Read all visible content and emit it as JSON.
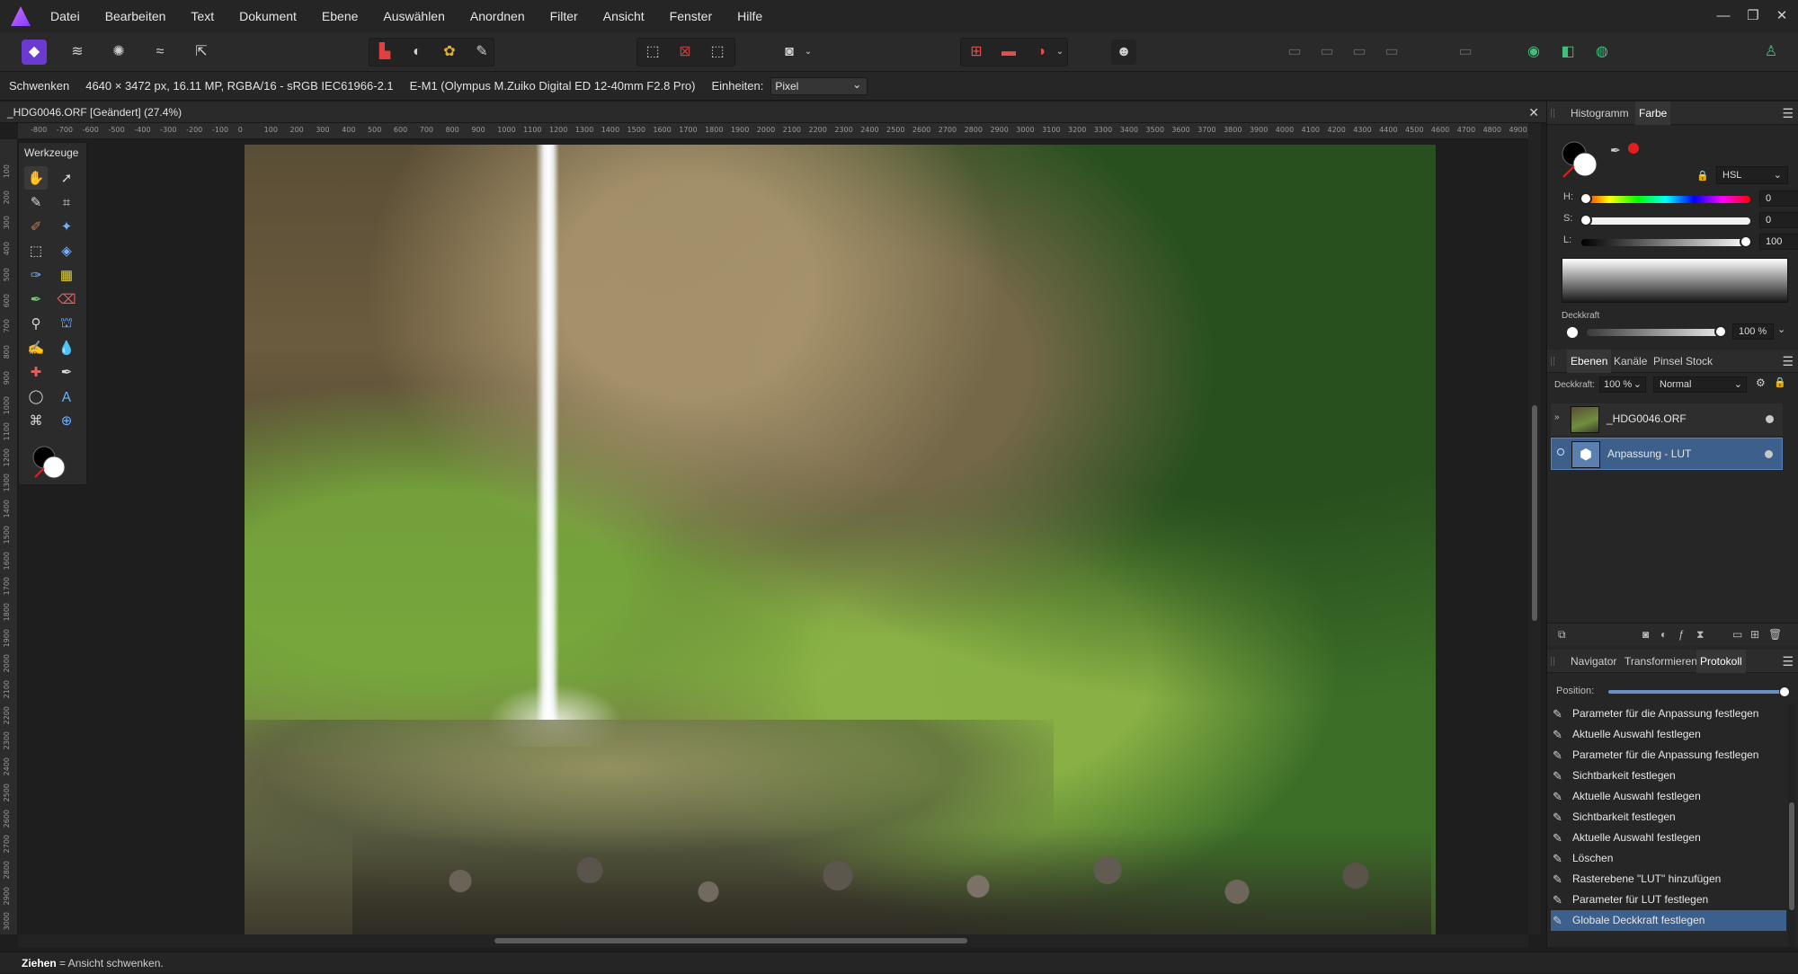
{
  "menubar": {
    "items": [
      "Datei",
      "Bearbeiten",
      "Text",
      "Dokument",
      "Ebene",
      "Auswählen",
      "Anordnen",
      "Filter",
      "Ansicht",
      "Fenster",
      "Hilfe"
    ],
    "window_controls": [
      "—",
      "❐",
      "✕"
    ]
  },
  "context": {
    "tool_name": "Schwenken",
    "image_info": "4640 × 3472 px, 16.11 MP, RGBA/16 - sRGB IEC61966-2.1",
    "camera_info": "E-M1 (Olympus M.Zuiko Digital ED 12-40mm F2.8 Pro)",
    "units_label": "Einheiten:",
    "units_value": "Pixel"
  },
  "document": {
    "tab_title": "_HDG0046.ORF [Geändert] (27.4%)",
    "close": "✕"
  },
  "rulers": {
    "horizontal": [
      "-800",
      "-700",
      "-600",
      "-500",
      "-400",
      "-300",
      "-200",
      "-100",
      "0",
      "100",
      "200",
      "300",
      "400",
      "500",
      "600",
      "700",
      "800",
      "900",
      "1000",
      "1100",
      "1200",
      "1300",
      "1400",
      "1500",
      "1600",
      "1700",
      "1800",
      "1900",
      "2000",
      "2100",
      "2200",
      "2300",
      "2400",
      "2500",
      "2600",
      "2700",
      "2800",
      "2900",
      "3000",
      "3100",
      "3200",
      "3300",
      "3400",
      "3500",
      "3600",
      "3700",
      "3800",
      "3900",
      "4000",
      "4100",
      "4200",
      "4300",
      "4400",
      "4500",
      "4600",
      "4700",
      "4800",
      "4900"
    ],
    "vertical": [
      "100",
      "200",
      "300",
      "400",
      "500",
      "600",
      "700",
      "800",
      "900",
      "1000",
      "1100",
      "1200",
      "1300",
      "1400",
      "1500",
      "1600",
      "1700",
      "1800",
      "1900",
      "2000",
      "2100",
      "2200",
      "2300",
      "2400",
      "2500",
      "2600",
      "2700",
      "2800",
      "2900",
      "3000",
      "3100"
    ]
  },
  "tools": {
    "title": "Werkzeuge"
  },
  "color_panel": {
    "tabs": [
      "Histogramm",
      "Farbe"
    ],
    "active_tab": "Farbe",
    "model": "HSL",
    "h_label": "H:",
    "h_value": "0",
    "s_label": "S:",
    "s_value": "0",
    "l_label": "L:",
    "l_value": "100",
    "opacity_label": "Deckkraft",
    "opacity_value": "100 %"
  },
  "layers_panel": {
    "tabs": [
      "Ebenen",
      "Kanäle",
      "Pinsel",
      "Stock"
    ],
    "active_tab": "Ebenen",
    "opacity_label": "Deckkraft:",
    "opacity_value": "100 %",
    "blend_mode": "Normal",
    "layers": [
      {
        "name": "_HDG0046.ORF",
        "selected": false
      },
      {
        "name": "Anpassung - LUT",
        "selected": true
      }
    ]
  },
  "history_panel": {
    "tabs": [
      "Navigator",
      "Transformieren",
      "Protokoll"
    ],
    "active_tab": "Protokoll",
    "position_label": "Position:",
    "position_fraction": 1.0,
    "items": [
      "Parameter für die Anpassung festlegen",
      "Aktuelle Auswahl festlegen",
      "Parameter für die Anpassung festlegen",
      "Sichtbarkeit festlegen",
      "Aktuelle Auswahl festlegen",
      "Sichtbarkeit festlegen",
      "Aktuelle Auswahl festlegen",
      "Löschen",
      "Rasterebene \"LUT\" hinzufügen",
      "Parameter für LUT festlegen",
      "Globale Deckkraft festlegen"
    ],
    "selected_index": 10
  },
  "status": {
    "action": "Ziehen",
    "description": " = Ansicht schwenken."
  },
  "colors": {
    "accent": "#4a6f9e",
    "selection": "#3d5f8c",
    "swatch_red": "#e02020"
  }
}
